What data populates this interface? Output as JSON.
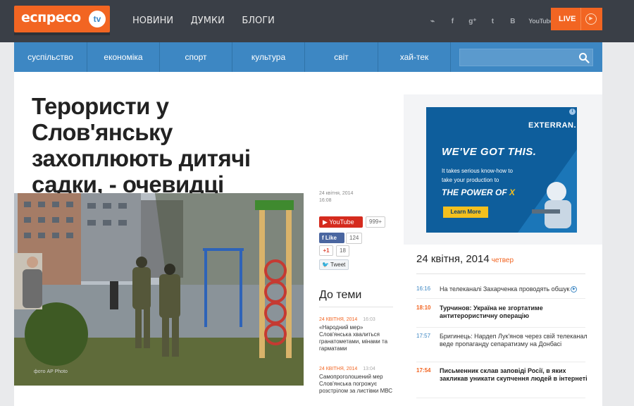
{
  "brand": {
    "logo_text": "еспресо",
    "logo_tv": "tv"
  },
  "topnav": [
    "НОВИНИ",
    "ДУМКИ",
    "БЛОГИ"
  ],
  "social": {
    "rss": "⌁",
    "facebook": "f",
    "googleplus": "g⁺",
    "twitter": "t",
    "vk": "B",
    "youtube": "YouTube"
  },
  "live": {
    "label": "LIVE",
    "play": "▶"
  },
  "categories": [
    "суспільство",
    "економіка",
    "спорт",
    "культура",
    "світ",
    "хай-тек"
  ],
  "search": {
    "placeholder": ""
  },
  "article": {
    "title": "Терористи у Слов'янську захоплюють дитячі садки, - очевидці",
    "date": "24 квітня, 2014",
    "time": "16:08",
    "photo_credit": "фото AP Photo"
  },
  "share": {
    "youtube_label": "YouTube",
    "youtube_count": "999+",
    "fb_label": "Like",
    "fb_count": "124",
    "gplus_label": "+1",
    "gplus_count": "18",
    "tweet_label": "Tweet"
  },
  "related": {
    "title": "До теми",
    "items": [
      {
        "date": "24 КВІТНЯ, 2014",
        "time": "16:03",
        "text": "«Народний мер» Слов'янська хвалиться гранатометами, мінами та гарматами"
      },
      {
        "date": "24 КВІТНЯ, 2014",
        "time": "13:04",
        "text": "Самопроголошений мер Слов'янська погрожує розстрілом за листівки МВС"
      }
    ]
  },
  "ad": {
    "logo": "EXTERRAN.",
    "headline": "WE'VE GOT THIS.",
    "line1": "It takes serious know-how to",
    "line2": "take your production to",
    "power": "THE POWER OF",
    "power_x": "X",
    "button": "Learn More",
    "info": "i"
  },
  "newsfeed": {
    "date": "24 квітня, 2014",
    "weekday": "четвер",
    "items": [
      {
        "time": "16:16",
        "text": "На телеканалі Захарченка проводять обшук",
        "bold": false,
        "video": true
      },
      {
        "time": "18:10",
        "text": "Турчинов: Україна не згортатиме антитерористичну операцію",
        "bold": true,
        "video": false
      },
      {
        "time": "17:57",
        "text": "Бригинець: Нардеп Лук'янов через свій телеканал веде пропаганду сепаратизму на Донбасі",
        "bold": false,
        "video": false
      },
      {
        "time": "17:54",
        "text": "Письменник склав заповіді Росії, в яких закликав уникати скупчення людей в інтернеті",
        "bold": true,
        "video": false
      }
    ]
  }
}
